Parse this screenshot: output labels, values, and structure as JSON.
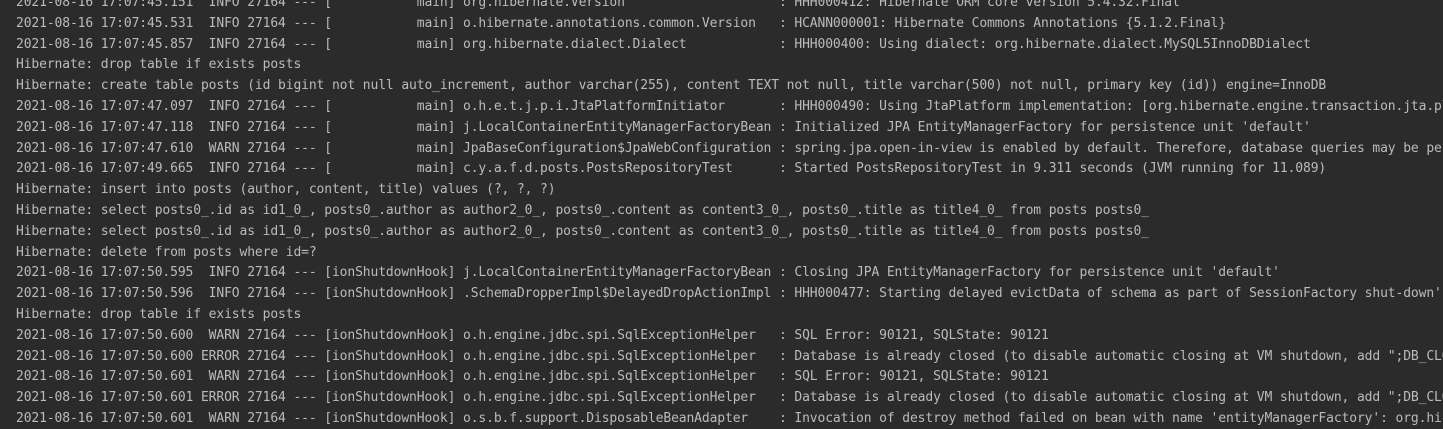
{
  "console": {
    "lines": [
      "2021-08-16 17:07:45.151  INFO 27164 --- [           main] org.hibernate.Version                    : HHH000412: Hibernate ORM core version 5.4.32.Final",
      "2021-08-16 17:07:45.531  INFO 27164 --- [           main] o.hibernate.annotations.common.Version   : HCANN000001: Hibernate Commons Annotations {5.1.2.Final}",
      "2021-08-16 17:07:45.857  INFO 27164 --- [           main] org.hibernate.dialect.Dialect            : HHH000400: Using dialect: org.hibernate.dialect.MySQL5InnoDBDialect",
      "Hibernate: drop table if exists posts",
      "Hibernate: create table posts (id bigint not null auto_increment, author varchar(255), content TEXT not null, title varchar(500) not null, primary key (id)) engine=InnoDB",
      "2021-08-16 17:07:47.097  INFO 27164 --- [           main] o.h.e.t.j.p.i.JtaPlatformInitiator       : HHH000490: Using JtaPlatform implementation: [org.hibernate.engine.transaction.jta.platform.internal.NoJtaPlatform]",
      "2021-08-16 17:07:47.118  INFO 27164 --- [           main] j.LocalContainerEntityManagerFactoryBean : Initialized JPA EntityManagerFactory for persistence unit 'default'",
      "2021-08-16 17:07:47.610  WARN 27164 --- [           main] JpaBaseConfiguration$JpaWebConfiguration : spring.jpa.open-in-view is enabled by default. Therefore, database queries may be performed during view rendering.",
      "2021-08-16 17:07:49.665  INFO 27164 --- [           main] c.y.a.f.d.posts.PostsRepositoryTest      : Started PostsRepositoryTest in 9.311 seconds (JVM running for 11.089)",
      "Hibernate: insert into posts (author, content, title) values (?, ?, ?)",
      "Hibernate: select posts0_.id as id1_0_, posts0_.author as author2_0_, posts0_.content as content3_0_, posts0_.title as title4_0_ from posts posts0_",
      "Hibernate: select posts0_.id as id1_0_, posts0_.author as author2_0_, posts0_.content as content3_0_, posts0_.title as title4_0_ from posts posts0_",
      "Hibernate: delete from posts where id=?",
      "2021-08-16 17:07:50.595  INFO 27164 --- [ionShutdownHook] j.LocalContainerEntityManagerFactoryBean : Closing JPA EntityManagerFactory for persistence unit 'default'",
      "2021-08-16 17:07:50.596  INFO 27164 --- [ionShutdownHook] .SchemaDropperImpl$DelayedDropActionImpl : HHH000477: Starting delayed evictData of schema as part of SessionFactory shut-down'",
      "Hibernate: drop table if exists posts",
      "2021-08-16 17:07:50.600  WARN 27164 --- [ionShutdownHook] o.h.engine.jdbc.spi.SqlExceptionHelper   : SQL Error: 90121, SQLState: 90121",
      "2021-08-16 17:07:50.600 ERROR 27164 --- [ionShutdownHook] o.h.engine.jdbc.spi.SqlExceptionHelper   : Database is already closed (to disable automatic closing at VM shutdown, add \";DB_CLOSE_ON_EXIT=FALSE\" to the db URL)",
      "2021-08-16 17:07:50.601  WARN 27164 --- [ionShutdownHook] o.h.engine.jdbc.spi.SqlExceptionHelper   : SQL Error: 90121, SQLState: 90121",
      "2021-08-16 17:07:50.601 ERROR 27164 --- [ionShutdownHook] o.h.engine.jdbc.spi.SqlExceptionHelper   : Database is already closed (to disable automatic closing at VM shutdown, add \";DB_CLOSE_ON_EXIT=FALSE\" to the db URL)",
      "2021-08-16 17:07:50.601  WARN 27164 --- [ionShutdownHook] o.s.b.f.support.DisposableBeanAdapter    : Invocation of destroy method failed on bean with name 'entityManagerFactory': org.hibernate.exception.JDBCConnectionException"
    ]
  },
  "colors": {
    "background": "#2b2b2b",
    "text": "#bbbbbb"
  }
}
